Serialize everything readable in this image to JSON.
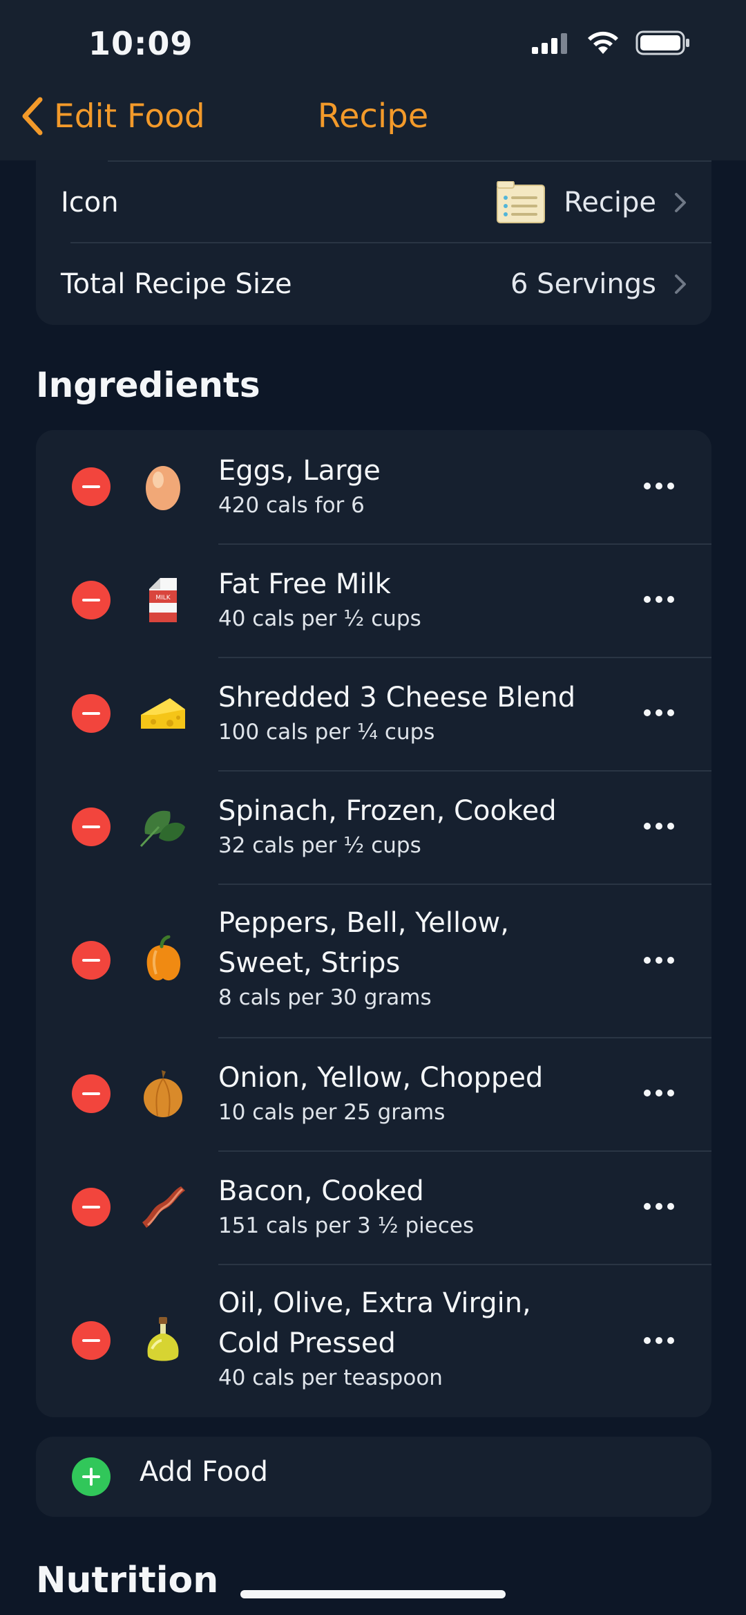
{
  "status_bar": {
    "time": "10:09"
  },
  "nav": {
    "back_label": "Edit Food",
    "title": "Recipe"
  },
  "settings": {
    "icon_label": "Icon",
    "icon_value": "Recipe",
    "size_label": "Total Recipe Size",
    "size_value": "6 Servings"
  },
  "ingredients": {
    "title": "Ingredients",
    "items": [
      {
        "name": "Eggs, Large",
        "cals": "420 cals for 6",
        "icon": "egg-icon"
      },
      {
        "name": "Fat Free Milk",
        "cals": "40 cals per ½ cups",
        "icon": "milk-carton-icon"
      },
      {
        "name": "Shredded 3 Cheese Blend",
        "cals": "100 cals per ¼ cups",
        "icon": "cheese-icon"
      },
      {
        "name": "Spinach, Frozen, Cooked",
        "cals": "32 cals per ½ cups",
        "icon": "spinach-icon"
      },
      {
        "name": "Peppers, Bell, Yellow,\nSweet, Strips",
        "cals": "8 cals per 30 grams",
        "icon": "bell-pepper-icon"
      },
      {
        "name": "Onion, Yellow, Chopped",
        "cals": "10 cals per 25 grams",
        "icon": "onion-icon"
      },
      {
        "name": "Bacon, Cooked",
        "cals": "151 cals per 3 ½ pieces",
        "icon": "bacon-icon"
      },
      {
        "name": "Oil, Olive, Extra Virgin,\nCold Pressed",
        "cals": "40 cals per teaspoon",
        "icon": "olive-oil-icon"
      }
    ]
  },
  "add_food": {
    "label": "Add Food"
  },
  "nutrition": {
    "title": "Nutrition"
  },
  "colors": {
    "accent": "#f39a2a",
    "remove": "#f2453d",
    "add": "#31c75a",
    "background": "#0d1727",
    "card": "#16202f"
  }
}
